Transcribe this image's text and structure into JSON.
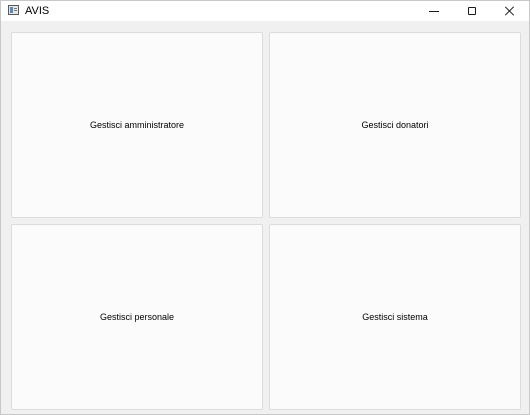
{
  "window": {
    "title": "AVIS",
    "icon": "app-window-icon"
  },
  "titlebar_buttons": {
    "minimize_icon": "minimize-icon",
    "maximize_icon": "maximize-icon",
    "close_icon": "close-icon"
  },
  "tiles": [
    {
      "label": "Gestisci amministratore"
    },
    {
      "label": "Gestisci donatori"
    },
    {
      "label": "Gestisci personale"
    },
    {
      "label": "Gestisci sistema"
    }
  ]
}
